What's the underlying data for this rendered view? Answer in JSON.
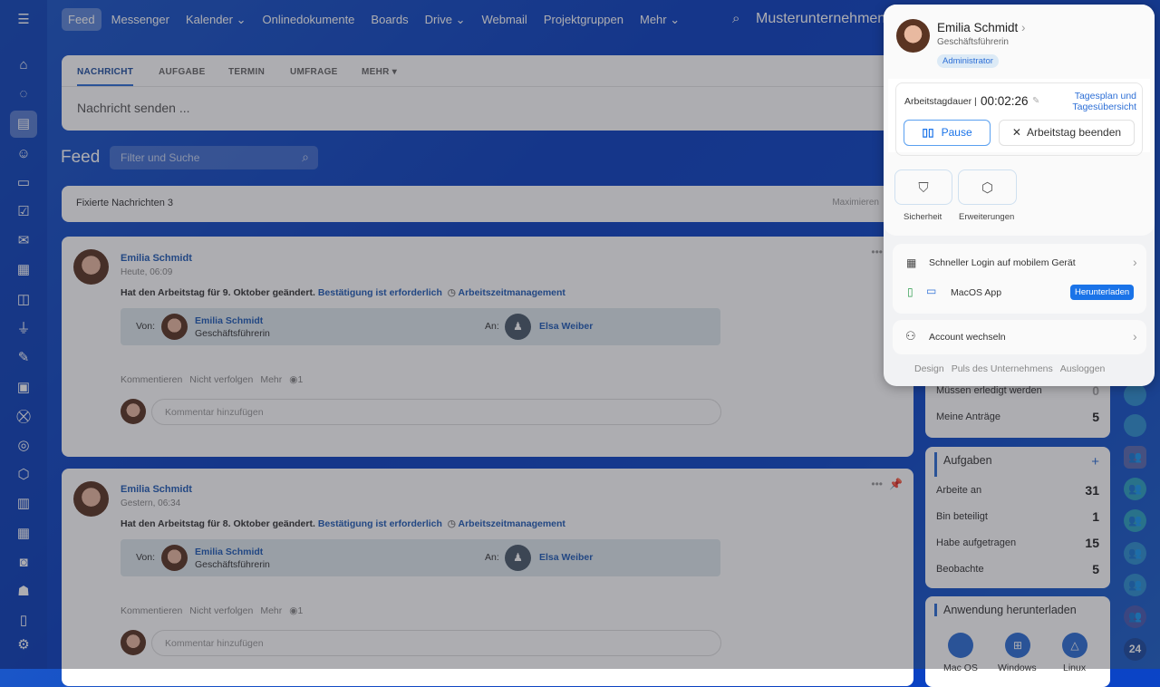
{
  "nav": {
    "items": [
      "Feed",
      "Messenger",
      "Kalender",
      "Onlinedokumente",
      "Boards",
      "Drive",
      "Webmail",
      "Projektgruppen",
      "Mehr"
    ],
    "company": "Musterunternehmen"
  },
  "composer": {
    "tabs": [
      "NACHRICHT",
      "AUFGABE",
      "TERMIN",
      "UMFRAGE",
      "MEHR"
    ],
    "placeholder": "Nachricht senden ..."
  },
  "feed": {
    "title": "Feed",
    "filter_placeholder": "Filter und Suche",
    "pinned_label": "Fixierte Nachrichten 3",
    "maximize": "Maximieren"
  },
  "posts": [
    {
      "author": "Emilia Schmidt",
      "time": "Heute, 06:09",
      "text": "Hat den Arbeitstag für 9. Oktober geändert.",
      "status": "Bestätigung ist erforderlich",
      "module": "Arbeitszeitmanagement",
      "from_label": "Von:",
      "from_name": "Emilia Schmidt",
      "from_role": "Geschäftsführerin",
      "to_label": "An:",
      "to_name": "Elsa Weiber",
      "actions": [
        "Kommentieren",
        "Nicht verfolgen",
        "Mehr"
      ],
      "views": "1",
      "comment_placeholder": "Kommentar hinzufügen"
    },
    {
      "author": "Emilia Schmidt",
      "time": "Gestern, 06:34",
      "text": "Hat den Arbeitstag für 8. Oktober geändert.",
      "status": "Bestätigung ist erforderlich",
      "module": "Arbeitszeitmanagement",
      "from_label": "Von:",
      "from_name": "Emilia Schmidt",
      "from_role": "Geschäftsführerin",
      "to_label": "An:",
      "to_name": "Elsa Weiber",
      "actions": [
        "Kommentieren",
        "Nicht verfolgen",
        "Mehr"
      ],
      "views": "1",
      "comment_placeholder": "Kommentar hinzufügen"
    }
  ],
  "requests": {
    "rows": [
      {
        "label": "Müssen erledigt werden",
        "value": "0"
      },
      {
        "label": "Meine Anträge",
        "value": "5"
      }
    ]
  },
  "tasks": {
    "title": "Aufgaben",
    "rows": [
      {
        "label": "Arbeite an",
        "value": "31"
      },
      {
        "label": "Bin beteiligt",
        "value": "1"
      },
      {
        "label": "Habe aufgetragen",
        "value": "15"
      },
      {
        "label": "Beobachte",
        "value": "5"
      }
    ]
  },
  "download": {
    "title": "Anwendung herunterladen",
    "apps": [
      "Mac OS",
      "Windows",
      "Linux"
    ]
  },
  "right_badge": "24",
  "profile": {
    "name": "Emilia Schmidt",
    "role": "Geschäftsführerin",
    "badge": "Administrator",
    "workday_label": "Arbeitstagdauer |",
    "workday_time": "00:02:26",
    "plan_link": "Tagesplan und Tagesübersicht",
    "pause": "Pause",
    "end_day": "Arbeitstag beenden",
    "security": "Sicherheit",
    "extensions": "Erweiterungen",
    "quick_login": "Schneller Login auf mobilem Gerät",
    "macos_app": "MacOS App",
    "download_btn": "Herunterladen",
    "switch_account": "Account wechseln",
    "footer": [
      "Design",
      "Puls des Unternehmens",
      "Ausloggen"
    ]
  },
  "colors": {
    "accent": "#2d6fd6",
    "brand_blue": "#0a3fc0",
    "download_btn": "#1a73e8"
  }
}
